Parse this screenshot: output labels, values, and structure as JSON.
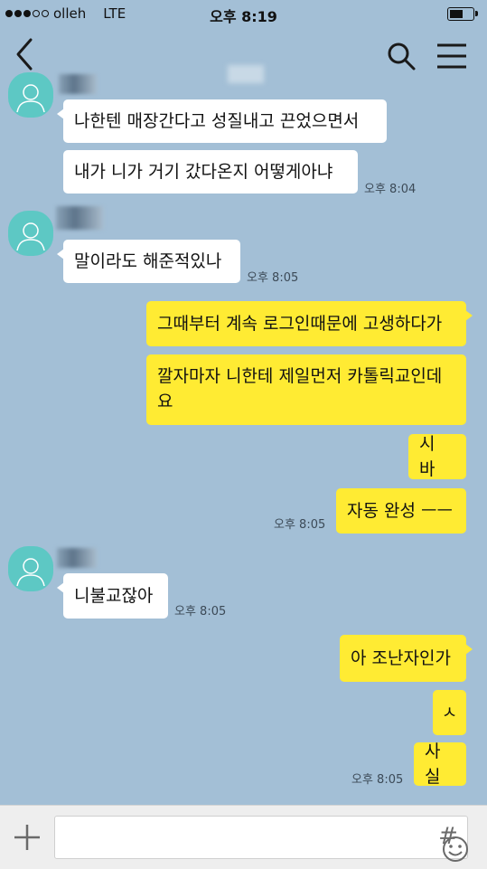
{
  "status": {
    "carrier": "olleh",
    "network": "LTE",
    "time": "오후 8:19",
    "battery_level": 0.6
  },
  "nav": {
    "back_icon": "chevron-left-icon",
    "search_icon": "search-icon",
    "menu_icon": "hamburger-menu-icon"
  },
  "messages": [
    {
      "side": "left",
      "text": "나한텐 매장간다고 성질내고 끈었으면서"
    },
    {
      "side": "left",
      "text": "내가 니가 거기 갔다온지 어떻게아냐",
      "time": "오후 8:04"
    },
    {
      "side": "left",
      "text": "말이라도 해준적있나",
      "time": "오후 8:05"
    },
    {
      "side": "right",
      "text": "그때부터 계속 로그인때문에 고생하다가"
    },
    {
      "side": "right",
      "text": "깔자마자 니한테 제일먼저 카톨릭교인데",
      "text2": "요"
    },
    {
      "side": "right",
      "text": "시 바"
    },
    {
      "side": "right",
      "text": "자동 완성 ㅡㅡ",
      "time": "오후 8:05"
    },
    {
      "side": "left",
      "text": "니불교잖아",
      "time": "오후 8:05"
    },
    {
      "side": "right",
      "text": "아 조난자인가"
    },
    {
      "side": "right",
      "text": "ㅅ"
    },
    {
      "side": "right",
      "text": "사실",
      "time": "오후 8:05"
    }
  ],
  "input": {
    "placeholder": "",
    "plus_icon": "plus-icon",
    "emoji_icon": "emoji-icon",
    "hash_label": "#"
  },
  "colors": {
    "background": "#a3bfd6",
    "my_bubble": "#ffeb33",
    "their_bubble": "#ffffff",
    "avatar": "#5dc8c4"
  }
}
